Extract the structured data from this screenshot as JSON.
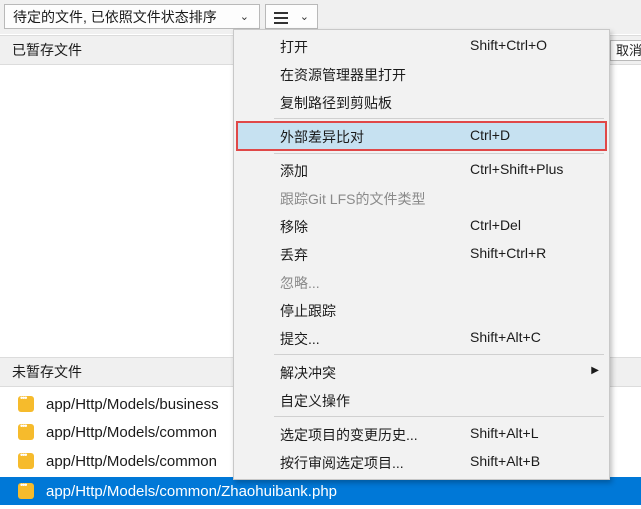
{
  "toolbar": {
    "sort_label": "待定的文件, 已依照文件状态排序",
    "chevron": "⌄"
  },
  "staged": {
    "header": "已暂存文件",
    "unstage_label": "取消"
  },
  "unstaged": {
    "header": "未暂存文件",
    "files": [
      {
        "name": "app/Http/Models/business",
        "icon": "modified-file-icon"
      },
      {
        "name": "app/Http/Models/common",
        "icon": "modified-file-icon"
      },
      {
        "name": "app/Http/Models/common",
        "icon": "modified-file-icon"
      },
      {
        "name": "app/Http/Models/common/Zhaohuibank.php",
        "icon": "modified-file-icon",
        "selected": true
      }
    ]
  },
  "context_menu": {
    "items": [
      {
        "label": "打开",
        "shortcut": "Shift+Ctrl+O"
      },
      {
        "label": "在资源管理器里打开",
        "shortcut": ""
      },
      {
        "label": "复制路径到剪贴板",
        "shortcut": ""
      },
      {
        "label": "外部差异比对",
        "shortcut": "Ctrl+D",
        "highlighted": true
      },
      {
        "label": "添加",
        "shortcut": "Ctrl+Shift+Plus"
      },
      {
        "label": "跟踪Git LFS的文件类型",
        "shortcut": "",
        "disabled": true
      },
      {
        "label": "移除",
        "shortcut": "Ctrl+Del"
      },
      {
        "label": "丢弃",
        "shortcut": "Shift+Ctrl+R"
      },
      {
        "label": "忽略...",
        "shortcut": "",
        "disabled": true
      },
      {
        "label": "停止跟踪",
        "shortcut": ""
      },
      {
        "label": "提交...",
        "shortcut": "Shift+Alt+C"
      },
      {
        "label": "解决冲突",
        "shortcut": "",
        "submenu": true
      },
      {
        "label": "自定义操作",
        "shortcut": ""
      },
      {
        "label": "选定项目的变更历史...",
        "shortcut": "Shift+Alt+L"
      },
      {
        "label": "按行审阅选定项目...",
        "shortcut": "Shift+Alt+B"
      }
    ],
    "submenu_arrow": "▶"
  },
  "colors": {
    "selection": "#0078d7",
    "menu_highlight": "#c6e1f1",
    "annotation_border": "#e04848",
    "file_icon": "#f6bb2c"
  }
}
